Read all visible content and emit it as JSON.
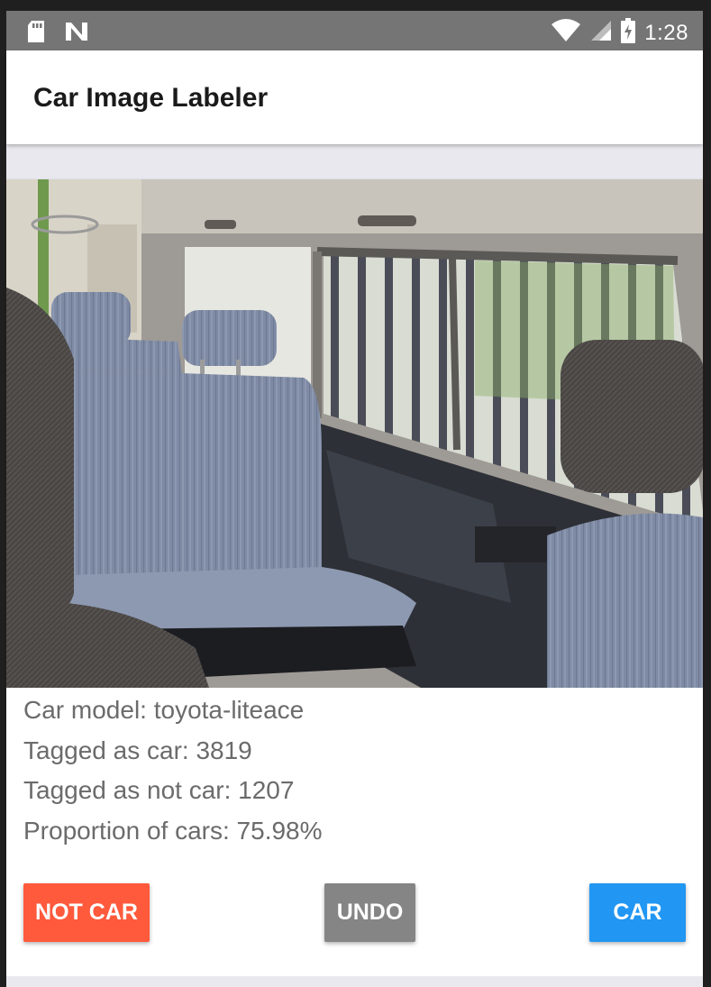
{
  "status_bar": {
    "time": "1:28",
    "icons": [
      "sd-card-icon",
      "n-notification-icon",
      "wifi-icon",
      "cell-signal-icon",
      "battery-icon"
    ]
  },
  "app_bar": {
    "title": "Car Image Labeler"
  },
  "photo": {
    "description_icon": "car-interior-photo"
  },
  "info": {
    "model": "Car model: toyota-liteace",
    "tagged_car": "Tagged as car: 3819",
    "tagged_not_car": "Tagged as not car: 1207",
    "proportion": "Proportion of cars: 75.98%"
  },
  "buttons": {
    "not_car": "NOT CAR",
    "undo": "UNDO",
    "car": "CAR"
  },
  "colors": {
    "not_car": "#ff5a3c",
    "undo": "#858585",
    "car": "#2196f3",
    "status_bar": "#757575"
  }
}
